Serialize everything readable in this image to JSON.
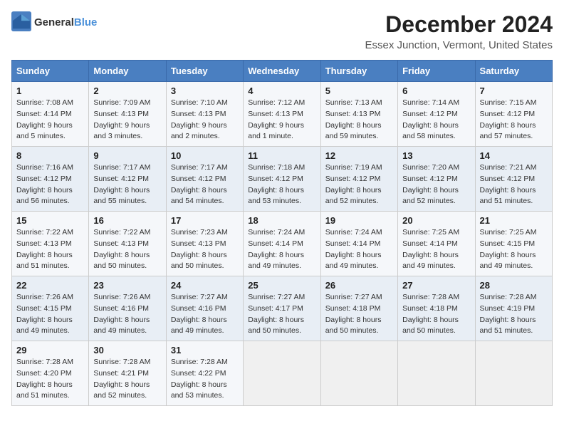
{
  "header": {
    "logo_general": "General",
    "logo_blue": "Blue",
    "title": "December 2024",
    "subtitle": "Essex Junction, Vermont, United States"
  },
  "calendar": {
    "days_of_week": [
      "Sunday",
      "Monday",
      "Tuesday",
      "Wednesday",
      "Thursday",
      "Friday",
      "Saturday"
    ],
    "weeks": [
      [
        {
          "day": "1",
          "sunrise": "Sunrise: 7:08 AM",
          "sunset": "Sunset: 4:14 PM",
          "daylight": "Daylight: 9 hours and 5 minutes."
        },
        {
          "day": "2",
          "sunrise": "Sunrise: 7:09 AM",
          "sunset": "Sunset: 4:13 PM",
          "daylight": "Daylight: 9 hours and 3 minutes."
        },
        {
          "day": "3",
          "sunrise": "Sunrise: 7:10 AM",
          "sunset": "Sunset: 4:13 PM",
          "daylight": "Daylight: 9 hours and 2 minutes."
        },
        {
          "day": "4",
          "sunrise": "Sunrise: 7:12 AM",
          "sunset": "Sunset: 4:13 PM",
          "daylight": "Daylight: 9 hours and 1 minute."
        },
        {
          "day": "5",
          "sunrise": "Sunrise: 7:13 AM",
          "sunset": "Sunset: 4:13 PM",
          "daylight": "Daylight: 8 hours and 59 minutes."
        },
        {
          "day": "6",
          "sunrise": "Sunrise: 7:14 AM",
          "sunset": "Sunset: 4:12 PM",
          "daylight": "Daylight: 8 hours and 58 minutes."
        },
        {
          "day": "7",
          "sunrise": "Sunrise: 7:15 AM",
          "sunset": "Sunset: 4:12 PM",
          "daylight": "Daylight: 8 hours and 57 minutes."
        }
      ],
      [
        {
          "day": "8",
          "sunrise": "Sunrise: 7:16 AM",
          "sunset": "Sunset: 4:12 PM",
          "daylight": "Daylight: 8 hours and 56 minutes."
        },
        {
          "day": "9",
          "sunrise": "Sunrise: 7:17 AM",
          "sunset": "Sunset: 4:12 PM",
          "daylight": "Daylight: 8 hours and 55 minutes."
        },
        {
          "day": "10",
          "sunrise": "Sunrise: 7:17 AM",
          "sunset": "Sunset: 4:12 PM",
          "daylight": "Daylight: 8 hours and 54 minutes."
        },
        {
          "day": "11",
          "sunrise": "Sunrise: 7:18 AM",
          "sunset": "Sunset: 4:12 PM",
          "daylight": "Daylight: 8 hours and 53 minutes."
        },
        {
          "day": "12",
          "sunrise": "Sunrise: 7:19 AM",
          "sunset": "Sunset: 4:12 PM",
          "daylight": "Daylight: 8 hours and 52 minutes."
        },
        {
          "day": "13",
          "sunrise": "Sunrise: 7:20 AM",
          "sunset": "Sunset: 4:12 PM",
          "daylight": "Daylight: 8 hours and 52 minutes."
        },
        {
          "day": "14",
          "sunrise": "Sunrise: 7:21 AM",
          "sunset": "Sunset: 4:12 PM",
          "daylight": "Daylight: 8 hours and 51 minutes."
        }
      ],
      [
        {
          "day": "15",
          "sunrise": "Sunrise: 7:22 AM",
          "sunset": "Sunset: 4:13 PM",
          "daylight": "Daylight: 8 hours and 51 minutes."
        },
        {
          "day": "16",
          "sunrise": "Sunrise: 7:22 AM",
          "sunset": "Sunset: 4:13 PM",
          "daylight": "Daylight: 8 hours and 50 minutes."
        },
        {
          "day": "17",
          "sunrise": "Sunrise: 7:23 AM",
          "sunset": "Sunset: 4:13 PM",
          "daylight": "Daylight: 8 hours and 50 minutes."
        },
        {
          "day": "18",
          "sunrise": "Sunrise: 7:24 AM",
          "sunset": "Sunset: 4:14 PM",
          "daylight": "Daylight: 8 hours and 49 minutes."
        },
        {
          "day": "19",
          "sunrise": "Sunrise: 7:24 AM",
          "sunset": "Sunset: 4:14 PM",
          "daylight": "Daylight: 8 hours and 49 minutes."
        },
        {
          "day": "20",
          "sunrise": "Sunrise: 7:25 AM",
          "sunset": "Sunset: 4:14 PM",
          "daylight": "Daylight: 8 hours and 49 minutes."
        },
        {
          "day": "21",
          "sunrise": "Sunrise: 7:25 AM",
          "sunset": "Sunset: 4:15 PM",
          "daylight": "Daylight: 8 hours and 49 minutes."
        }
      ],
      [
        {
          "day": "22",
          "sunrise": "Sunrise: 7:26 AM",
          "sunset": "Sunset: 4:15 PM",
          "daylight": "Daylight: 8 hours and 49 minutes."
        },
        {
          "day": "23",
          "sunrise": "Sunrise: 7:26 AM",
          "sunset": "Sunset: 4:16 PM",
          "daylight": "Daylight: 8 hours and 49 minutes."
        },
        {
          "day": "24",
          "sunrise": "Sunrise: 7:27 AM",
          "sunset": "Sunset: 4:16 PM",
          "daylight": "Daylight: 8 hours and 49 minutes."
        },
        {
          "day": "25",
          "sunrise": "Sunrise: 7:27 AM",
          "sunset": "Sunset: 4:17 PM",
          "daylight": "Daylight: 8 hours and 50 minutes."
        },
        {
          "day": "26",
          "sunrise": "Sunrise: 7:27 AM",
          "sunset": "Sunset: 4:18 PM",
          "daylight": "Daylight: 8 hours and 50 minutes."
        },
        {
          "day": "27",
          "sunrise": "Sunrise: 7:28 AM",
          "sunset": "Sunset: 4:18 PM",
          "daylight": "Daylight: 8 hours and 50 minutes."
        },
        {
          "day": "28",
          "sunrise": "Sunrise: 7:28 AM",
          "sunset": "Sunset: 4:19 PM",
          "daylight": "Daylight: 8 hours and 51 minutes."
        }
      ],
      [
        {
          "day": "29",
          "sunrise": "Sunrise: 7:28 AM",
          "sunset": "Sunset: 4:20 PM",
          "daylight": "Daylight: 8 hours and 51 minutes."
        },
        {
          "day": "30",
          "sunrise": "Sunrise: 7:28 AM",
          "sunset": "Sunset: 4:21 PM",
          "daylight": "Daylight: 8 hours and 52 minutes."
        },
        {
          "day": "31",
          "sunrise": "Sunrise: 7:28 AM",
          "sunset": "Sunset: 4:22 PM",
          "daylight": "Daylight: 8 hours and 53 minutes."
        },
        null,
        null,
        null,
        null
      ]
    ]
  }
}
